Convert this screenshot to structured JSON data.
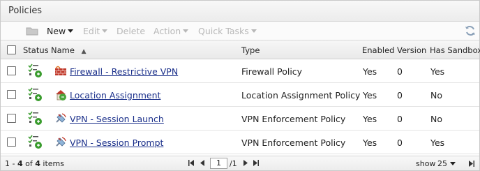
{
  "panel": {
    "title": "Policies"
  },
  "toolbar": {
    "new_label": "New",
    "edit_label": "Edit",
    "delete_label": "Delete",
    "action_label": "Action",
    "quick_tasks_label": "Quick Tasks"
  },
  "table": {
    "columns": [
      "Status",
      "Name",
      "Type",
      "Enabled",
      "Version",
      "Has Sandbox"
    ],
    "sort_indicator": "▲",
    "rows": [
      {
        "name": "Firewall - Restrictive VPN",
        "type": "Firewall Policy",
        "enabled": "Yes",
        "version": "0",
        "sandbox": "Yes",
        "icon": "firewall-brick-icon"
      },
      {
        "name": "Location Assignment",
        "type": "Location Assignment Policy",
        "enabled": "Yes",
        "version": "0",
        "sandbox": "No",
        "icon": "location-house-icon"
      },
      {
        "name": "VPN - Session Launch",
        "type": "VPN Enforcement Policy",
        "enabled": "Yes",
        "version": "0",
        "sandbox": "No",
        "icon": "vpn-satellite-icon"
      },
      {
        "name": "VPN - Session Prompt",
        "type": "VPN Enforcement Policy",
        "enabled": "Yes",
        "version": "0",
        "sandbox": "Yes",
        "icon": "vpn-satellite-icon"
      }
    ]
  },
  "footer": {
    "range_start": "1",
    "range_sep": " - ",
    "range_end": "4",
    "of_label": " of ",
    "total": "4",
    "items_label": " items",
    "page_value": "1",
    "page_total": "/1",
    "show_label": "show",
    "page_size": "25"
  },
  "colors": {
    "link": "#1a2f8a",
    "disabled": "#b8b8b8",
    "status_green": "#3a9c2e"
  }
}
